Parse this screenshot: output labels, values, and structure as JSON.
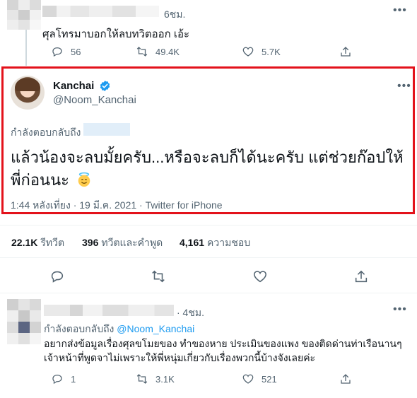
{
  "top_tweet": {
    "time": "6ชม.",
    "text": "ศุลโทรมาบอกให้ลบทวิตออก เอ้ะ",
    "actions": {
      "replies": "56",
      "retweets": "49.4K",
      "likes": "5.7K"
    }
  },
  "main_tweet": {
    "display_name": "Kanchai",
    "handle": "@Noom_Kanchai",
    "replying_to_label": "กำลังตอบกลับถึง",
    "text": "แล้วน้องจะลบมั้ยครับ...หรือจะลบก็ได้นะครับ แต่ช่วยก๊อปให้พี่ก่อนนะ",
    "emoji_icon": "smiling-face-with-halo-icon",
    "timestamp": "1:44 หลังเที่ยง · 19 มี.ค. 2021 · Twitter for iPhone",
    "highlight_color": "#e3121b"
  },
  "stats": {
    "retweets_count": "22.1K",
    "retweets_label": "รีทวีต",
    "quotes_count": "396",
    "quotes_label": "ทวีตและคำพูด",
    "likes_count": "4,161",
    "likes_label": "ความชอบ"
  },
  "bottom_tweet": {
    "time": "· 4ชม.",
    "replying_to_label": "กำลังตอบกลับถึง",
    "replying_to_mention": "@Noom_Kanchai",
    "text_line1": "อยากส่งข้อมูลเรื่องศุลขโมยของ ทำของหาย ประเมินของแพง ของติดด่านท่าเรือนานๆ",
    "text_line2": "เจ้าหน้าที่พูดจาไม่เพราะให้พี่หนุ่มเกี่ยวกับเรื่องพวกนี้บ้างจังเลยค่ะ",
    "actions": {
      "replies": "1",
      "retweets": "3.1K",
      "likes": "521"
    }
  },
  "colors": {
    "accent": "#1d9bf0",
    "muted": "#536471",
    "text": "#0f1419"
  }
}
